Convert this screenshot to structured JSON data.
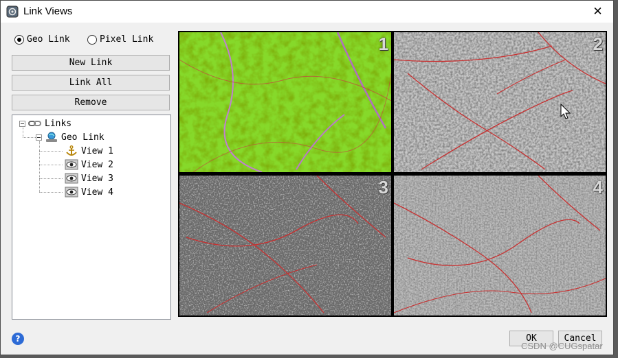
{
  "window": {
    "title": "Link Views",
    "close_glyph": "✕"
  },
  "link_mode": {
    "options": [
      {
        "label": "Geo Link",
        "selected": true
      },
      {
        "label": "Pixel Link",
        "selected": false
      }
    ]
  },
  "buttons": {
    "new_link": "New Link",
    "link_all": "Link All",
    "remove": "Remove"
  },
  "tree": {
    "root": "Links",
    "group": "Geo Link",
    "views": [
      "View 1",
      "View 2",
      "View 3",
      "View 4"
    ]
  },
  "views": [
    {
      "number": "1",
      "style": "color-terrain"
    },
    {
      "number": "2",
      "style": "gray-hillshade"
    },
    {
      "number": "3",
      "style": "gray-dark"
    },
    {
      "number": "4",
      "style": "gray-light"
    }
  ],
  "footer": {
    "help": "?",
    "ok": "OK",
    "cancel": "Cancel"
  },
  "watermark": "CSDN @CUGspatar",
  "colors": {
    "accent": "#2d6bd6",
    "fault_line": "#c83030",
    "terrain_green": "#7ed321"
  }
}
